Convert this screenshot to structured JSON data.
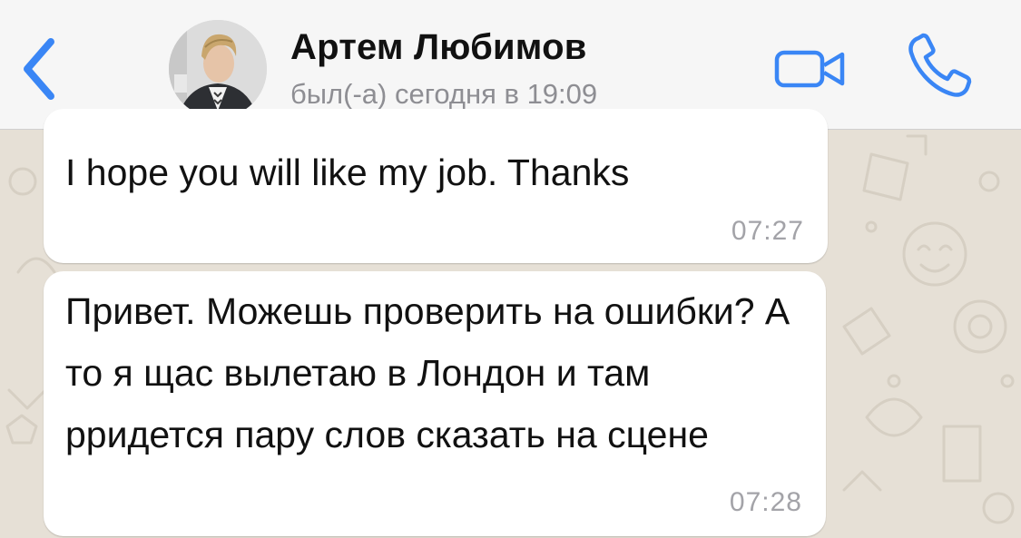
{
  "header": {
    "contact_name": "Артем Любимов",
    "status": "был(-а) сегодня в 19:09",
    "back_icon": "chevron-left-icon",
    "video_icon": "video-camera-icon",
    "call_icon": "phone-icon",
    "accent_color": "#3a86f5"
  },
  "messages": [
    {
      "text": "I hope you will like my job. Thanks",
      "time": "07:27"
    },
    {
      "text": "Привет. Можешь проверить на ошибки? А то я щас вылетаю в Лондон и там рридется пару слов сказать на сцене",
      "time": "07:28"
    }
  ]
}
